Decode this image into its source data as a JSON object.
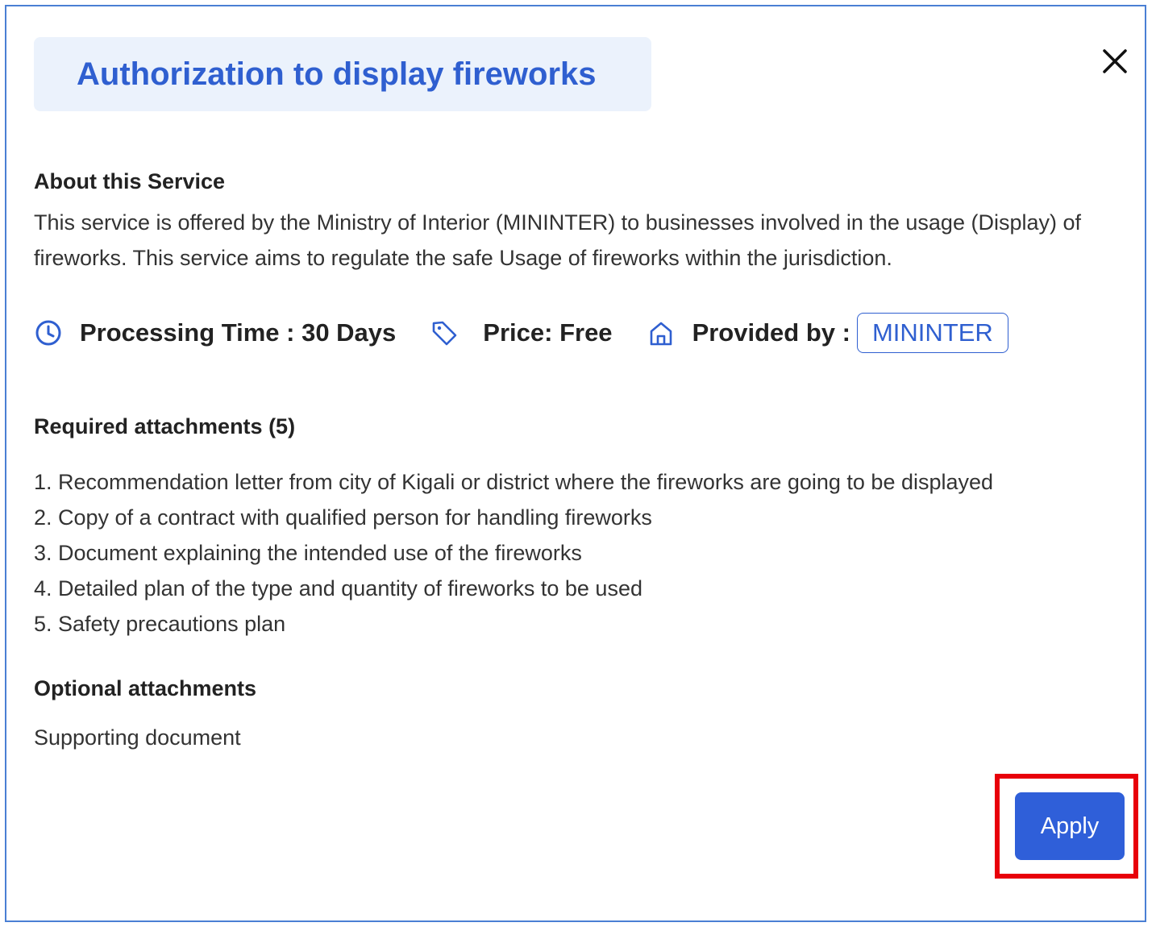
{
  "dialog": {
    "title": "Authorization to display fireworks",
    "close_icon": "close-icon"
  },
  "about": {
    "heading": "About this Service",
    "text": "This service is offered by the Ministry of Interior (MININTER) to businesses involved in the usage (Display) of fireworks. This service aims to regulate the safe Usage of fireworks within the jurisdiction."
  },
  "meta": {
    "processing_time": "Processing Time : 30 Days",
    "price": "Price: Free",
    "provided_by_label": "Provided by :",
    "provider": "MININTER",
    "icons": [
      "clock-icon",
      "tag-icon",
      "home-icon"
    ]
  },
  "required": {
    "heading": "Required attachments (5)",
    "items": [
      "1. Recommendation letter from city of Kigali or district where the fireworks are going to be displayed",
      "2. Copy of a contract with qualified person for handling fireworks",
      "3. Document explaining the intended use of the fireworks",
      "4. Detailed plan of the type and quantity of fireworks to be used",
      "5. Safety precautions plan"
    ]
  },
  "optional": {
    "heading": "Optional attachments",
    "text": "Supporting document"
  },
  "actions": {
    "apply_label": "Apply"
  },
  "colors": {
    "accent": "#2f5fd0",
    "title_bg": "#ebf2fc",
    "button_bg": "#2f5fd9",
    "highlight": "#e8000b",
    "modal_border": "#4a7fd4"
  }
}
